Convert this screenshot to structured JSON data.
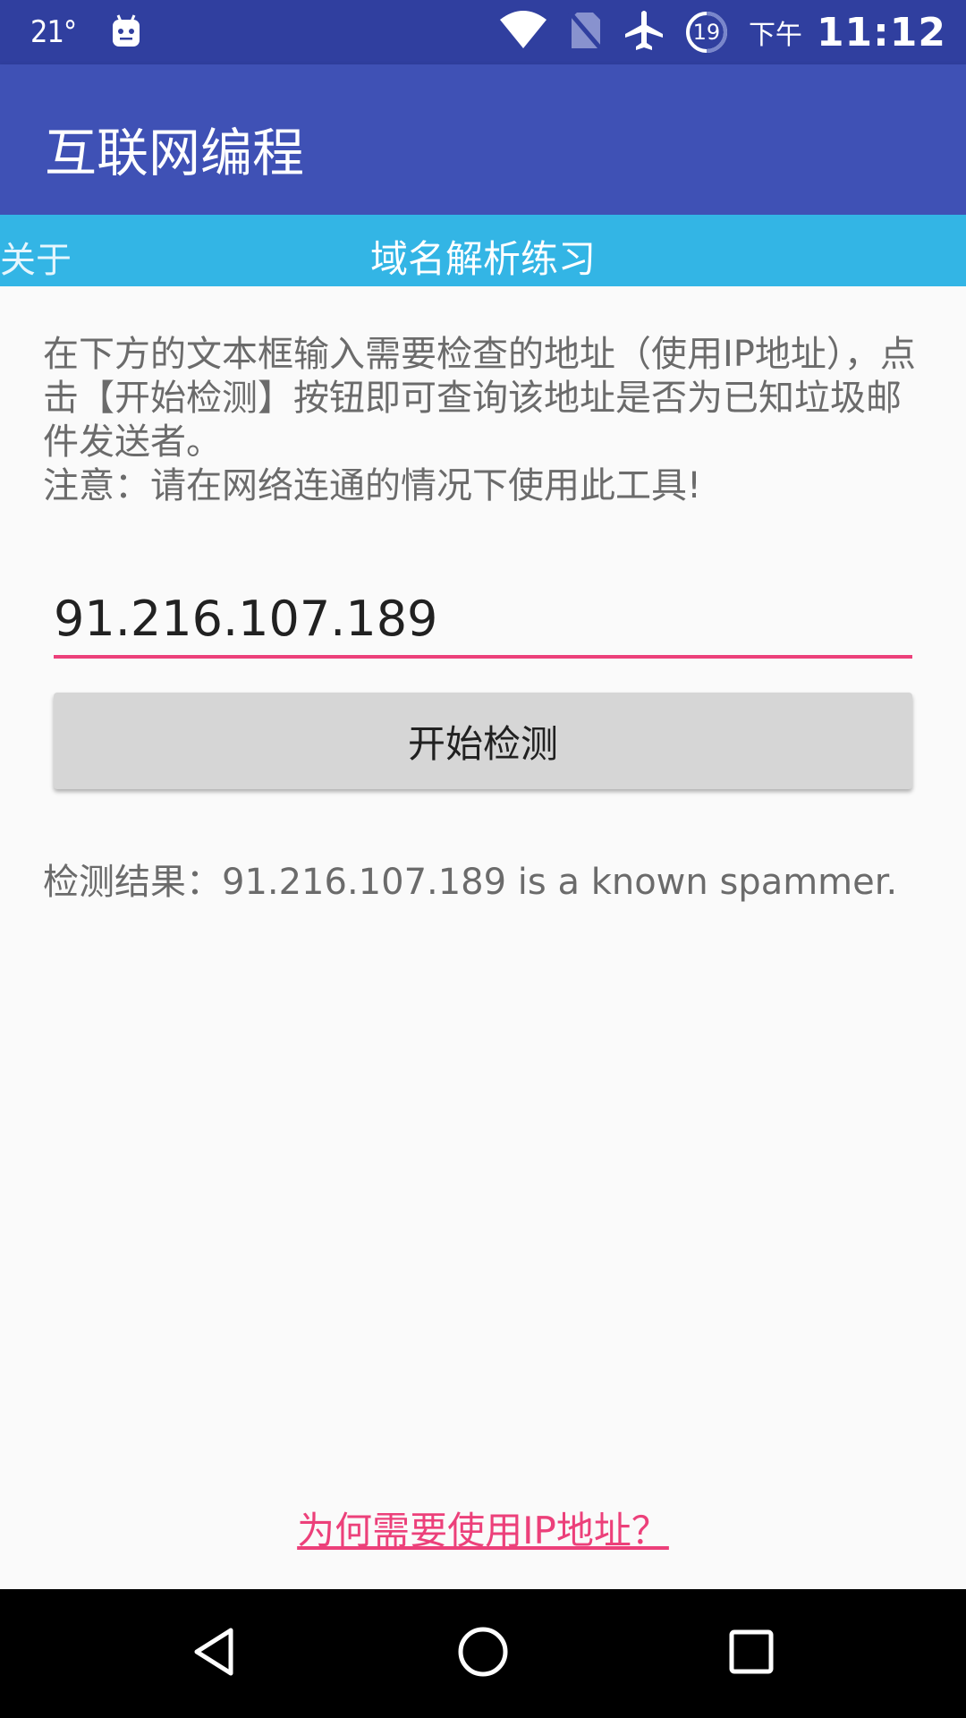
{
  "status_bar": {
    "temperature": "21°",
    "battery_level": "19",
    "ampm": "下午",
    "time": "11:12",
    "icons": [
      "weather-icon",
      "android-notification-icon",
      "wifi-icon",
      "no-sim-icon",
      "airplane-mode-icon",
      "battery-saver-icon"
    ]
  },
  "app_bar": {
    "title": "互联网编程"
  },
  "tab_bar": {
    "about_label": "关于",
    "title": "域名解析练习"
  },
  "instructions": {
    "line1": "在下方的文本框输入需要检查的地址（使用IP地址），点击【开始检测】按钮即可查询该地址是否为已知垃圾邮件发送者。",
    "line2": "注意：请在网络连通的情况下使用此工具!"
  },
  "ip_input": {
    "value": "91.216.107.189"
  },
  "check_button": {
    "label": "开始检测"
  },
  "result": {
    "text": "检测结果：91.216.107.189 is a known spammer."
  },
  "help_link": {
    "label": "为何需要使用IP地址？"
  },
  "nav_bar": {
    "buttons": [
      "back-icon",
      "home-icon",
      "recents-icon"
    ]
  },
  "colors": {
    "status_bar": "#303f9f",
    "app_bar": "#3f51b5",
    "tab_bar": "#33b5e5",
    "accent": "#ec407a"
  }
}
